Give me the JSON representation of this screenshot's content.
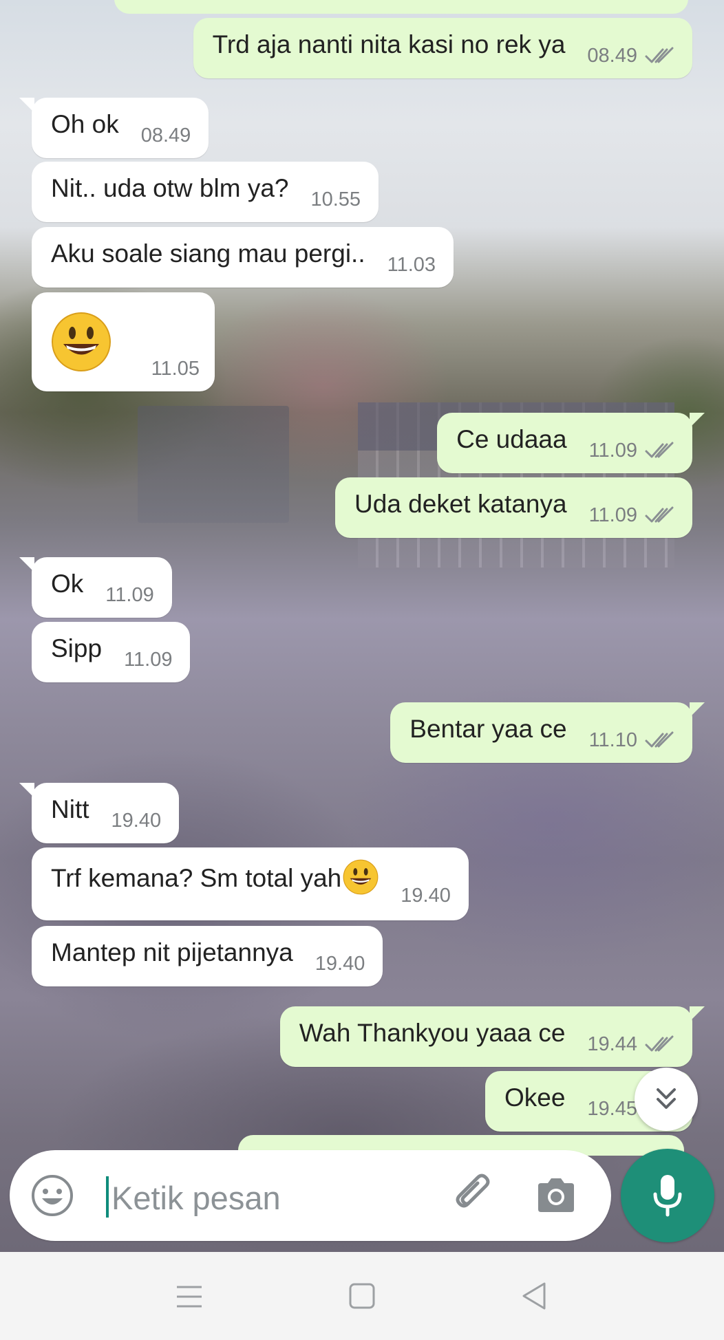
{
  "colors": {
    "incoming_bubble": "#ffffff",
    "outgoing_bubble": "#e4fad1",
    "accent": "#1e8f78",
    "tick": "#8a8f93"
  },
  "messages": [
    {
      "text": "Trd aja nanti nita kasi no rek ya",
      "time": "08.49",
      "dir": "out"
    },
    {
      "text": "Oh ok",
      "time": "08.49",
      "dir": "in"
    },
    {
      "text": "Nit.. uda otw blm ya?",
      "time": "10.55",
      "dir": "in"
    },
    {
      "text": "Aku soale siang mau pergi..",
      "time": "11.03",
      "dir": "in"
    },
    {
      "text": "",
      "time": "11.05",
      "dir": "in",
      "emoji": "grinning-face"
    },
    {
      "text": "Ce udaaa",
      "time": "11.09",
      "dir": "out"
    },
    {
      "text": "Uda deket katanya",
      "time": "11.09",
      "dir": "out"
    },
    {
      "text": "Ok",
      "time": "11.09",
      "dir": "in"
    },
    {
      "text": "Sipp",
      "time": "11.09",
      "dir": "in"
    },
    {
      "text": "Bentar yaa ce",
      "time": "11.10",
      "dir": "out"
    },
    {
      "text": "Nitt",
      "time": "19.40",
      "dir": "in"
    },
    {
      "text": "Trf kemana? Sm total yah",
      "time": "19.40",
      "dir": "in",
      "emoji": "grinning-face"
    },
    {
      "text": "Mantep nit pijetannya",
      "time": "19.40",
      "dir": "in"
    },
    {
      "text": "Wah Thankyou yaaa ce",
      "time": "19.44",
      "dir": "out"
    },
    {
      "text": "Okee",
      "time": "19.45",
      "dir": "out"
    }
  ],
  "composer": {
    "placeholder": "Ketik pesan",
    "emoji_icon": "emoji-face-icon",
    "attach_icon": "paperclip-icon",
    "camera_icon": "camera-icon",
    "send_icon": "microphone-icon"
  },
  "scroll_button_icon": "double-chevron-down-icon",
  "navbar": {
    "menu_icon": "hamburger-icon",
    "home_icon": "square-home-icon",
    "back_icon": "triangle-back-icon"
  }
}
